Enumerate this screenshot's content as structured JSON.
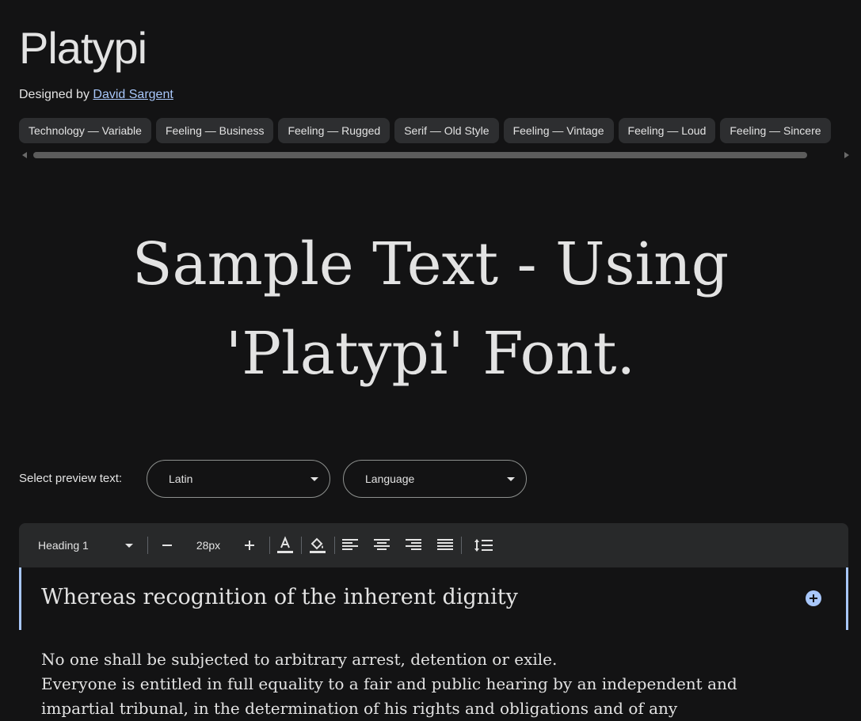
{
  "header": {
    "title": "Platypi",
    "designed_by_prefix": "Designed by",
    "designer_name": "David Sargent"
  },
  "tags": [
    "Technology — Variable",
    "Feeling — Business",
    "Feeling — Rugged",
    "Serif — Old Style",
    "Feeling — Vintage",
    "Feeling — Loud",
    "Feeling — Sincere"
  ],
  "sample": {
    "line1": "Sample Text - Using",
    "line2": "'Platypi' Font."
  },
  "preview": {
    "label": "Select preview text:",
    "script_value": "Latin",
    "language_placeholder": "Language"
  },
  "toolbar": {
    "style_value": "Heading 1",
    "font_size": "28px",
    "icons": [
      "text-color-icon",
      "highlight-color-icon",
      "align-left-icon",
      "align-center-icon",
      "align-right-icon",
      "align-justify-icon",
      "line-spacing-icon"
    ]
  },
  "editor": {
    "heading_text": "Whereas recognition of the inherent dignity"
  },
  "body": {
    "line1": "No one shall be subjected to arbitrary arrest, detention or exile.",
    "line2": "Everyone is entitled in full equality to a fair and public hearing by an independent and",
    "line3": "impartial tribunal, in the determination of his rights and obligations and of any"
  },
  "colors": {
    "background": "#131314",
    "chip_bg": "#2d2e30",
    "link": "#a8c7fa",
    "toolbar_bg": "#28292a",
    "accent": "#a8c7fa"
  }
}
